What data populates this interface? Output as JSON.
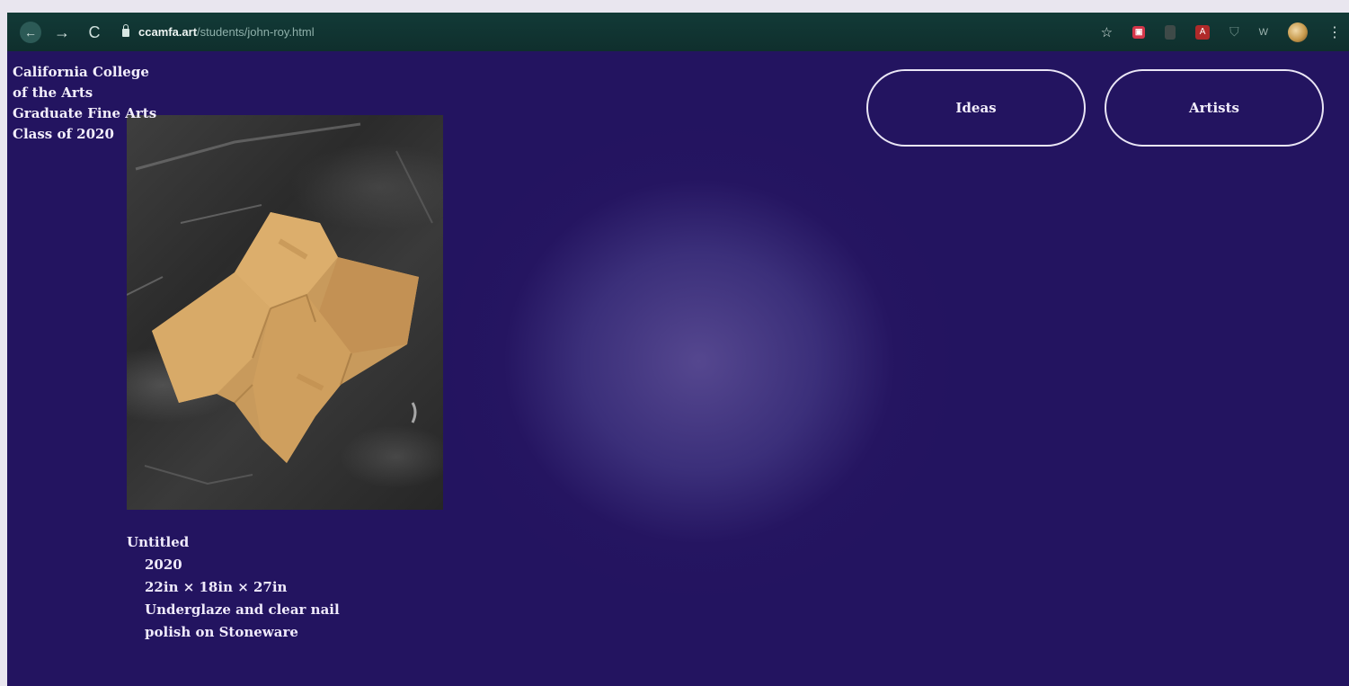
{
  "browser": {
    "url_host": "ccamfa.art",
    "url_path": "/students/john-roy.html",
    "nav": {
      "back": "←",
      "forward": "→",
      "reload": "C"
    },
    "icons": [
      "star-icon",
      "extension-red-icon",
      "extension-dark-icon",
      "acrobat-icon",
      "shield-icon",
      "wm-extension-icon",
      "profile-avatar-icon",
      "menu-icon"
    ]
  },
  "site": {
    "title_lines": [
      "California College",
      "of the Arts",
      "Graduate Fine Arts",
      "Class of 2020"
    ]
  },
  "nav": {
    "ideas": "Ideas",
    "artists": "Artists"
  },
  "artwork": {
    "title": "Untitled",
    "year": "2020",
    "dimensions": "22in × 18in × 27in",
    "medium_line1": "Underglaze and clear nail",
    "medium_line2": "polish on Stoneware"
  },
  "colors": {
    "page_bg": "#231460",
    "glow": "#55478f",
    "toolbar": "#123a37",
    "text": "#f2eefb"
  }
}
